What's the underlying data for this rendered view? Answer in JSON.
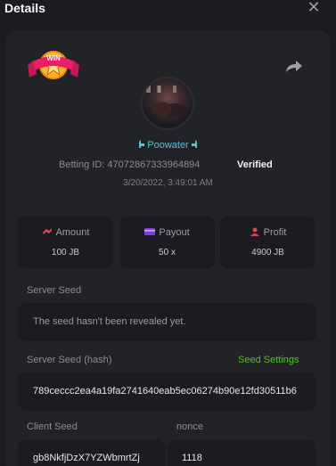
{
  "header": {
    "title": "Details",
    "close_icon": "close-icon"
  },
  "bet": {
    "username": "Poowater",
    "betting_id_label": "Betting ID:",
    "betting_id": "47072867333964894",
    "verified": "Verified",
    "datetime": "3/20/2022, 3:49:01 AM"
  },
  "stats": {
    "amount_label": "Amount",
    "amount_value": "100 JB",
    "payout_label": "Payout",
    "payout_value": "50 x",
    "profit_label": "Profit",
    "profit_value": "4900 JB"
  },
  "server_seed": {
    "label": "Server Seed",
    "value": "The seed hasn't been revealed yet."
  },
  "server_seed_hash": {
    "label": "Server Seed (hash)",
    "settings_link": "Seed Settings",
    "value": "789ceccc2ea4a19fa2741640eab5ec06274b90e12fd30511b6"
  },
  "client_seed": {
    "label": "Client Seed",
    "value": "gb8NkfjDzX7YZWbmrtZj"
  },
  "nonce": {
    "label": "nonce",
    "value": "1118"
  },
  "badge": {
    "text": "WIN"
  },
  "colors": {
    "accent_green": "#4ec227",
    "username": "#4fc3d9",
    "amount_icon": "#e8405a",
    "payout_icon": "#7b3fe4",
    "profit_icon": "#e8405a"
  }
}
